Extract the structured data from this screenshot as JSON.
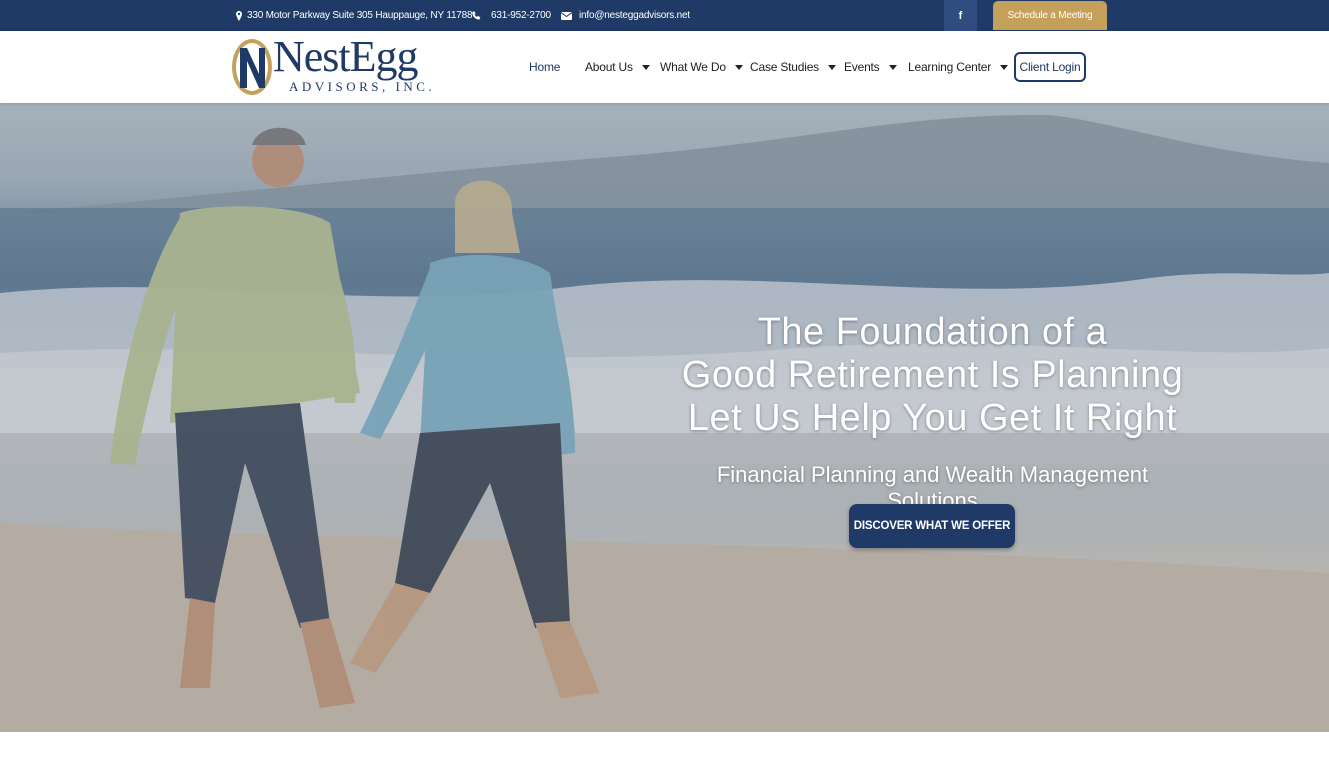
{
  "topbar": {
    "address": "330 Motor Parkway Suite 305 Hauppauge, NY 11788",
    "phone": "631-952-2700",
    "email": "info@nesteggadvisors.net",
    "facebook_glyph": "f",
    "schedule_label": "Schedule a Meeting"
  },
  "logo": {
    "word": "NestEgg",
    "sub": "ADVISORS, INC."
  },
  "nav": {
    "items": [
      {
        "label": "Home"
      },
      {
        "label": "About Us"
      },
      {
        "label": "What We Do"
      },
      {
        "label": "Case Studies"
      },
      {
        "label": "Events"
      },
      {
        "label": "Learning Center"
      }
    ],
    "login_label": "Client Login"
  },
  "hero": {
    "headline_1": "The Foundation of a",
    "headline_2": "Good Retirement Is Planning",
    "headline_3": "Let Us Help You Get It Right",
    "subline": "Financial Planning and Wealth Management Solutions",
    "cta_label": "DISCOVER WHAT WE OFFER"
  },
  "colors": {
    "brand_navy": "#1f3a66",
    "brand_gold": "#c5a05a"
  },
  "icons": [
    "map-pin-icon",
    "phone-icon",
    "envelope-icon",
    "facebook-icon",
    "caret-down-icon"
  ]
}
